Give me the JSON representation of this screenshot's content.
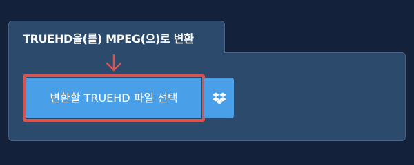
{
  "converter": {
    "title": "TRUEHD을(를) MPEG(으)로 변환",
    "choose_button_label": "변환할 TRUEHD 파일 선택",
    "dropbox_icon": "dropbox-icon",
    "arrow_icon": "arrow-down-icon"
  },
  "colors": {
    "background": "#13223a",
    "panel": "#2c4a6b",
    "button": "#4aa0e8",
    "highlight": "#d9534f"
  }
}
